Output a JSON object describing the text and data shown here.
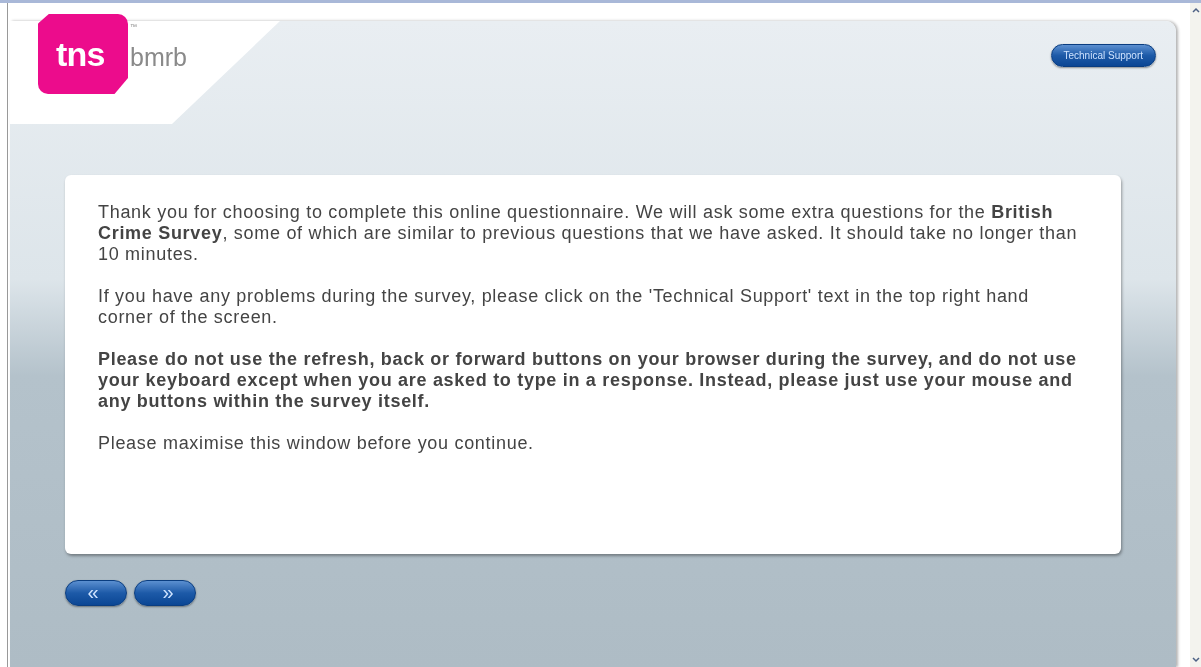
{
  "logo": {
    "mark": "tns",
    "name": "bmrb",
    "trademark": "™"
  },
  "support_button": "Technical Support",
  "paragraphs": [
    {
      "text": "Thank you for choosing to complete this online questionnaire. We will ask some extra questions for the **British Crime Survey**, some of which are similar to previous questions that we have asked. It should take no longer than 10 minutes.",
      "bold": false
    },
    {
      "text": "If you have any problems during the survey, please click on the 'Technical Support' text in the top right hand corner of the screen.",
      "bold": false
    },
    {
      "text": "Please do not use the refresh, back or forward buttons on your browser during the survey, and do not use your keyboard except when you are asked to type in a response. Instead, please just use your mouse and any buttons within the survey itself.",
      "bold": true
    },
    {
      "text": "Please maximise this window before you continue.",
      "bold": false
    }
  ],
  "nav_buttons": [
    {
      "label": "«",
      "kind": "back"
    },
    {
      "label": "»",
      "kind": "next"
    }
  ]
}
